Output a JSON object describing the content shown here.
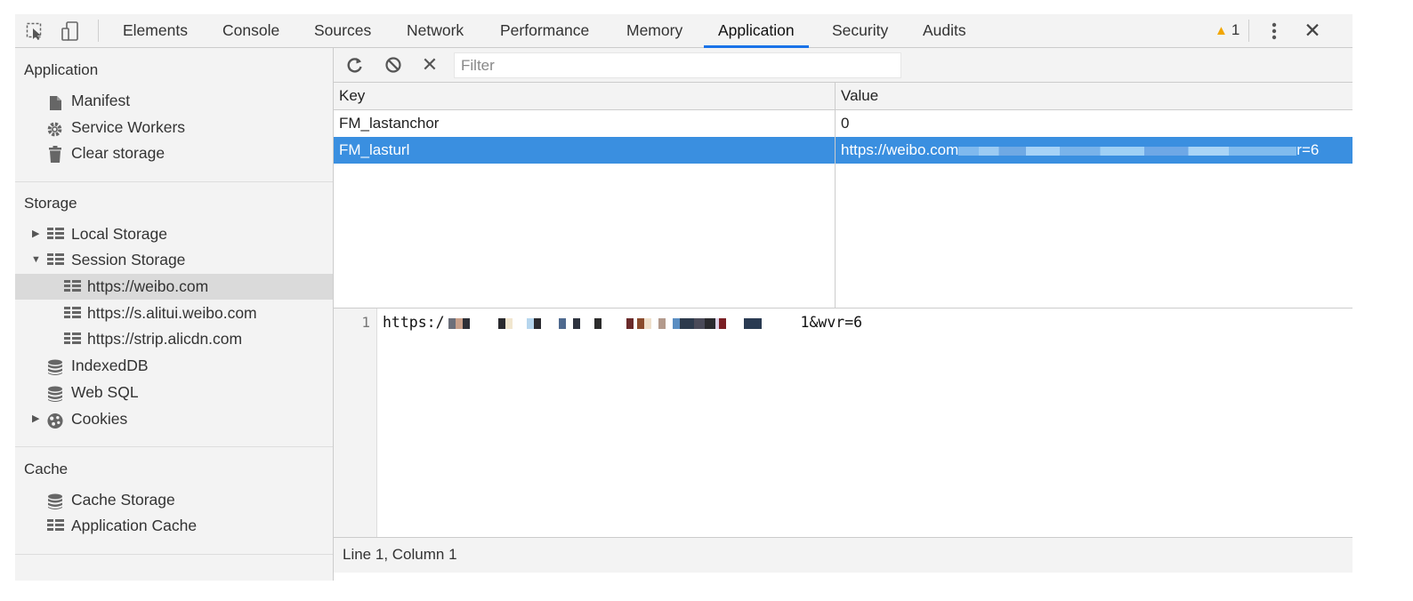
{
  "toolbar": {
    "inspect_icon": "inspect-cursor-icon",
    "device_icon": "device-toggle-icon",
    "tabs": [
      {
        "label": "Elements"
      },
      {
        "label": "Console"
      },
      {
        "label": "Sources"
      },
      {
        "label": "Network"
      },
      {
        "label": "Performance"
      },
      {
        "label": "Memory"
      },
      {
        "label": "Application",
        "active": true
      },
      {
        "label": "Security"
      },
      {
        "label": "Audits"
      }
    ],
    "warning_count": "1",
    "accent_color": "#1a73e8",
    "warning_color": "#f2a600"
  },
  "sidebar": {
    "application": {
      "title": "Application",
      "items": [
        {
          "label": "Manifest",
          "icon": "file-icon"
        },
        {
          "label": "Service Workers",
          "icon": "gear-icon"
        },
        {
          "label": "Clear storage",
          "icon": "trash-icon"
        }
      ]
    },
    "storage": {
      "title": "Storage",
      "items": [
        {
          "label": "Local Storage",
          "icon": "table-icon",
          "expanded": false
        },
        {
          "label": "Session Storage",
          "icon": "table-icon",
          "expanded": true
        },
        {
          "label": "https://weibo.com",
          "icon": "table-icon",
          "selected": true
        },
        {
          "label": "https://s.alitui.weibo.com",
          "icon": "table-icon"
        },
        {
          "label": "https://strip.alicdn.com",
          "icon": "table-icon"
        },
        {
          "label": "IndexedDB",
          "icon": "database-icon"
        },
        {
          "label": "Web SQL",
          "icon": "database-icon"
        },
        {
          "label": "Cookies",
          "icon": "cookie-icon",
          "expanded": false
        }
      ]
    },
    "cache": {
      "title": "Cache",
      "items": [
        {
          "label": "Cache Storage",
          "icon": "database-icon"
        },
        {
          "label": "Application Cache",
          "icon": "table-icon"
        }
      ]
    }
  },
  "filterbar": {
    "refresh_icon": "refresh-icon",
    "clear_all_icon": "block-icon",
    "delete_icon": "close-icon",
    "filter_placeholder": "Filter"
  },
  "table": {
    "columns": [
      "Key",
      "Value"
    ],
    "rows": [
      {
        "key": "FM_lastanchor",
        "value": "0"
      },
      {
        "key": "FM_lasturl",
        "value_prefix": "https://weibo.com",
        "value_suffix": "r=6",
        "selected": true
      }
    ],
    "selected_color": "#3a8fe0"
  },
  "editor": {
    "line_number": "1",
    "code_prefix": "https:/",
    "code_suffix": "1&wvr=6"
  },
  "status": {
    "text": "Line 1, Column 1"
  }
}
